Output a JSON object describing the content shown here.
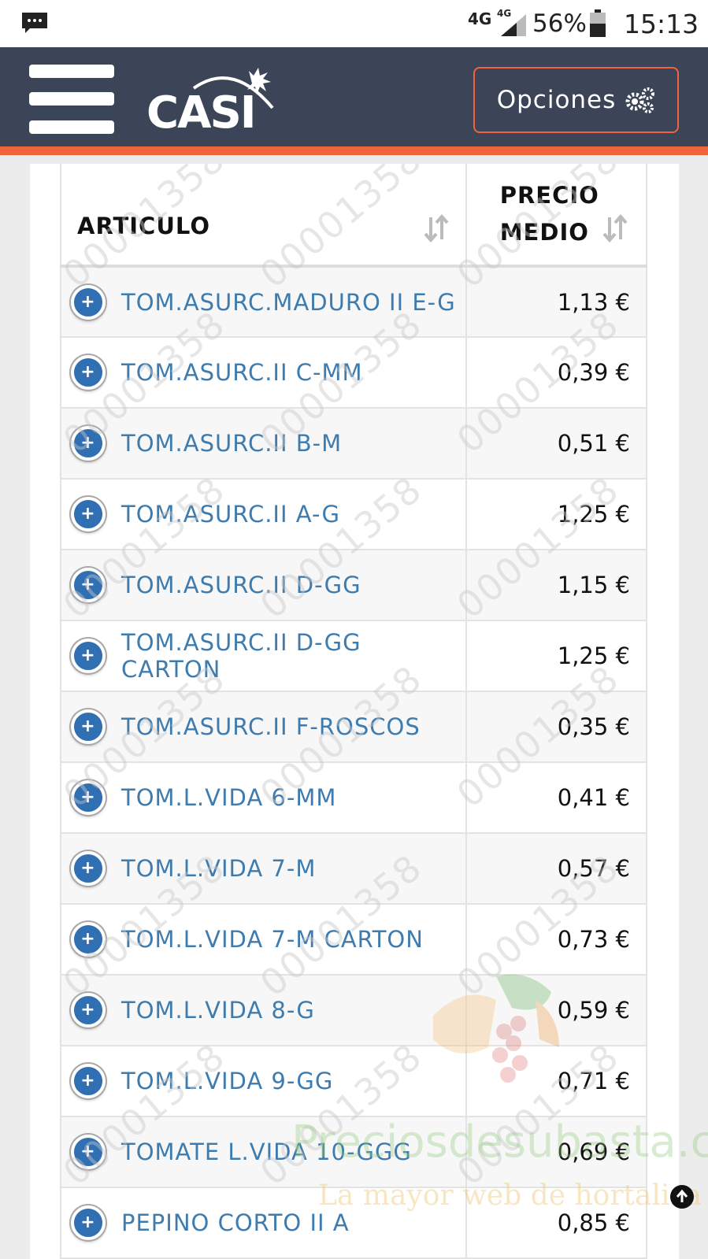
{
  "status_bar": {
    "network": "4G",
    "network_small": "4G",
    "battery": "56%",
    "time": "15:13"
  },
  "header": {
    "logo_text": "CASI",
    "options_label": "Opciones"
  },
  "table": {
    "headers": {
      "article": "ARTICULO",
      "price_line1": "PRECIO",
      "price_line2": "MEDIO"
    },
    "rows": [
      {
        "article": "TOM.ASURC.MADURO II E-G",
        "price": "1,13 €"
      },
      {
        "article": "TOM.ASURC.II C-MM",
        "price": "0,39 €"
      },
      {
        "article": "TOM.ASURC.II B-M",
        "price": "0,51 €"
      },
      {
        "article": "TOM.ASURC.II A-G",
        "price": "1,25 €"
      },
      {
        "article": "TOM.ASURC.II D-GG",
        "price": "1,15 €"
      },
      {
        "article": "TOM.ASURC.II D-GG CARTON",
        "price": "1,25 €"
      },
      {
        "article": "TOM.ASURC.II F-ROSCOS",
        "price": "0,35 €"
      },
      {
        "article": "TOM.L.VIDA 6-MM",
        "price": "0,41 €"
      },
      {
        "article": "TOM.L.VIDA 7-M",
        "price": "0,57 €"
      },
      {
        "article": "TOM.L.VIDA 7-M CARTON",
        "price": "0,73 €"
      },
      {
        "article": "TOM.L.VIDA 8-G",
        "price": "0,59 €"
      },
      {
        "article": "TOM.L.VIDA 9-GG",
        "price": "0,71 €"
      },
      {
        "article": "TOMATE L.VIDA 10-GGG",
        "price": "0,69 €"
      },
      {
        "article": "PEPINO CORTO II A",
        "price": "0,85 €"
      }
    ]
  },
  "watermark": {
    "site": "Preciosdesubasta.com",
    "tagline": "La mayor web de hortaliza",
    "digits": "00001358"
  },
  "colors": {
    "header_bg": "#3b4557",
    "accent": "#f0643a",
    "link": "#3e7bae",
    "plus_button": "#2f6fb2"
  }
}
